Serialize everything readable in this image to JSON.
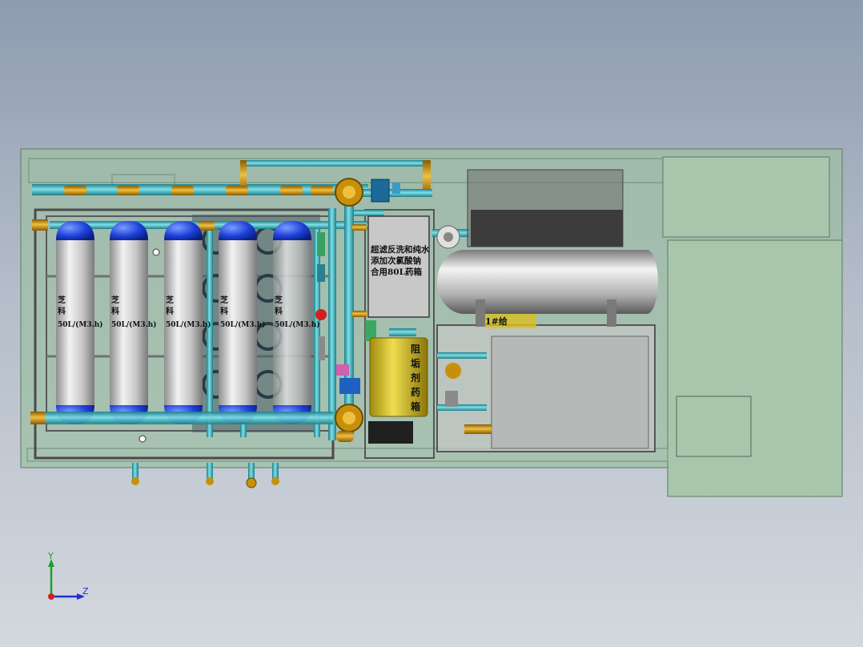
{
  "vessel_label_prefix": "芝\n科",
  "vessels": [
    {
      "line1": "芝",
      "line2": "科",
      "spec": "50L/(M3.h)"
    },
    {
      "line1": "芝",
      "line2": "科",
      "spec": "50L/(M3.h)"
    },
    {
      "line1": "芝",
      "line2": "科",
      "spec": "50L/(M3.h)"
    },
    {
      "line1": "芝",
      "line2": "科",
      "spec": "50L/(M3.h)"
    },
    {
      "line1": "芝",
      "line2": "科",
      "spec": "50L/(M3.h)"
    }
  ],
  "dosing_box": {
    "line1": "超滤反洗和纯水",
    "line2": "添加次氯酸钠",
    "line3": "合用80L药箱"
  },
  "scale_tank": {
    "chars": [
      "阻",
      "垢",
      "剂",
      "药",
      "箱"
    ]
  },
  "tank_band_text": "1#给",
  "axes": {
    "y": "Y",
    "z": "Z"
  },
  "colors": {
    "frame": "#98b8a0",
    "pipe": "#3aa8b0",
    "vessel_cap": "#1a3fd0",
    "vessel_body": "#c8c8c8",
    "fitting": "#c8900a",
    "scale_tank": "#d8c020"
  }
}
